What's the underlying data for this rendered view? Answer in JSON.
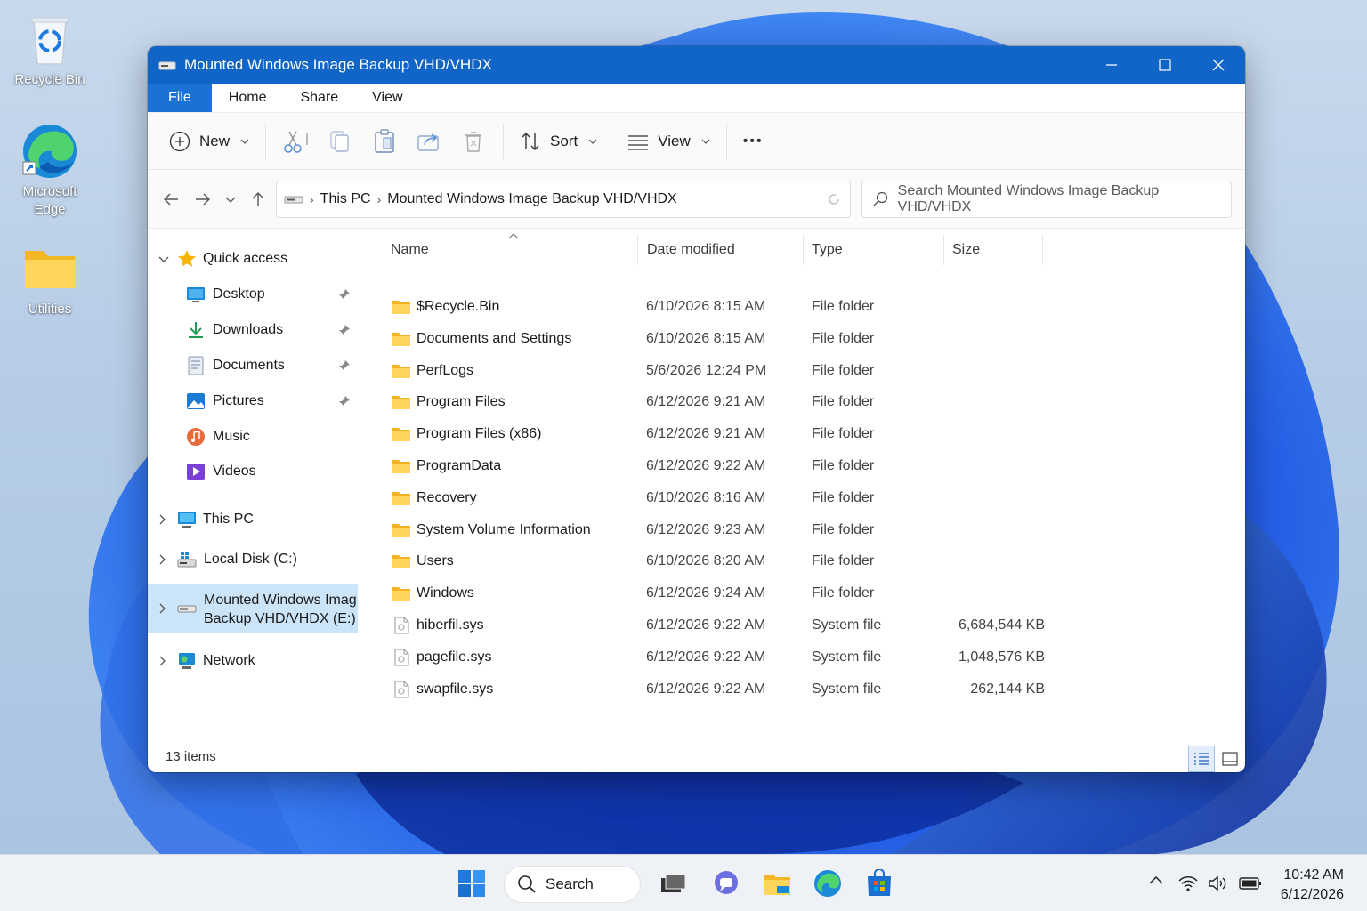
{
  "desktop": {
    "icons": [
      {
        "label": "Recycle Bin"
      },
      {
        "label": "Microsoft Edge"
      },
      {
        "label": "Utilities"
      }
    ]
  },
  "window": {
    "title": "Mounted Windows Image Backup VHD/VHDX",
    "menu": [
      "File",
      "Home",
      "Share",
      "View"
    ],
    "toolbar": {
      "new_label": "New",
      "sort_label": "Sort",
      "view_label": "View",
      "more_label": "•••"
    },
    "address": {
      "crumbs": [
        "This PC",
        "Mounted Windows Image Backup VHD/VHDX"
      ]
    },
    "search": {
      "placeholder": "Search Mounted Windows Image Backup VHD/VHDX"
    },
    "nav": {
      "quick_access": "Quick access",
      "items": [
        {
          "label": "Desktop",
          "icon": "desktop-icon",
          "pinned": true
        },
        {
          "label": "Downloads",
          "icon": "downloads-icon",
          "pinned": true
        },
        {
          "label": "Documents",
          "icon": "documents-icon",
          "pinned": true
        },
        {
          "label": "Pictures",
          "icon": "pictures-icon",
          "pinned": true
        },
        {
          "label": "Music",
          "icon": "music-icon",
          "pinned": false
        },
        {
          "label": "Videos",
          "icon": "videos-icon",
          "pinned": false
        }
      ],
      "this_pc": "This PC",
      "local_disk": "Local Disk (C:)",
      "mounted_line1": "Mounted Windows Imag",
      "mounted_line2": "Backup VHD/VHDX (E:)",
      "network": "Network"
    },
    "columns": {
      "name": "Name",
      "date": "Date modified",
      "type": "Type",
      "size": "Size"
    },
    "files": [
      {
        "name": "$Recycle.Bin",
        "date": "6/10/2026 8:15 AM",
        "type": "File folder",
        "size": "",
        "kind": "folder"
      },
      {
        "name": "Documents and Settings",
        "date": "6/10/2026 8:15 AM",
        "type": "File folder",
        "size": "",
        "kind": "folder"
      },
      {
        "name": "PerfLogs",
        "date": "5/6/2026 12:24 PM",
        "type": "File folder",
        "size": "",
        "kind": "folder"
      },
      {
        "name": "Program Files",
        "date": "6/12/2026 9:21 AM",
        "type": "File folder",
        "size": "",
        "kind": "folder"
      },
      {
        "name": "Program Files (x86)",
        "date": "6/12/2026 9:21 AM",
        "type": "File folder",
        "size": "",
        "kind": "folder"
      },
      {
        "name": "ProgramData",
        "date": "6/12/2026 9:22 AM",
        "type": "File folder",
        "size": "",
        "kind": "folder"
      },
      {
        "name": "Recovery",
        "date": "6/10/2026 8:16 AM",
        "type": "File folder",
        "size": "",
        "kind": "folder"
      },
      {
        "name": "System Volume Information",
        "date": "6/12/2026 9:23 AM",
        "type": "File folder",
        "size": "",
        "kind": "folder"
      },
      {
        "name": "Users",
        "date": "6/10/2026 8:20 AM",
        "type": "File folder",
        "size": "",
        "kind": "folder"
      },
      {
        "name": "Windows",
        "date": "6/12/2026 9:24 AM",
        "type": "File folder",
        "size": "",
        "kind": "folder"
      },
      {
        "name": "hiberfil.sys",
        "date": "6/12/2026 9:22 AM",
        "type": "System file",
        "size": "6,684,544 KB",
        "kind": "file"
      },
      {
        "name": "pagefile.sys",
        "date": "6/12/2026 9:22 AM",
        "type": "System file",
        "size": "1,048,576 KB",
        "kind": "file"
      },
      {
        "name": "swapfile.sys",
        "date": "6/12/2026 9:22 AM",
        "type": "System file",
        "size": "262,144 KB",
        "kind": "file"
      }
    ],
    "status": "13 items"
  },
  "taskbar": {
    "search_label": "Search",
    "time": "10:42 AM",
    "date": "6/12/2026"
  },
  "colors": {
    "titlebar": "#1065c6",
    "accent": "#1a73d4",
    "folder": "#ffc83d",
    "selection": "#cce4f7"
  }
}
